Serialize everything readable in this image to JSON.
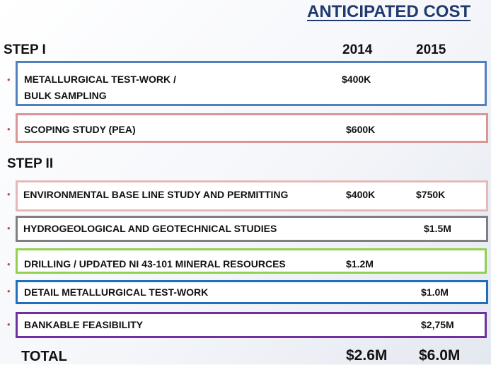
{
  "title": "ANTICIPATED COST",
  "header": {
    "step1": "STEP I",
    "step2": "STEP II",
    "year1": "2014",
    "year2": "2015"
  },
  "bullet": "•",
  "colors": {
    "title": "#1f3a6e",
    "bullet": "#c0504d",
    "blue": "#4f81bd",
    "rose": "#d99694",
    "pink": "#e6b9b8",
    "gray": "#7f7f7f",
    "green": "#92d050",
    "darkblue": "#1f6fbf",
    "purple": "#7030a0"
  },
  "items": [
    {
      "label_line1": "METALLURGICAL TEST-WORK /",
      "label_line2": "BULK SAMPLING",
      "v2014": "$400K",
      "v2015": ""
    },
    {
      "label": "SCOPING STUDY (PEA)",
      "v2014": "$600K",
      "v2015": ""
    },
    {
      "label": "ENVIRONMENTAL BASE LINE STUDY AND PERMITTING",
      "v2014": "$400K",
      "v2015": "$750K"
    },
    {
      "label": "HYDROGEOLOGICAL AND GEOTECHNICAL STUDIES",
      "v2014": "",
      "v2015": "$1.5M"
    },
    {
      "label": "DRILLING / UPDATED NI 43-101 MINERAL RESOURCES",
      "v2014": "$1.2M",
      "v2015": ""
    },
    {
      "label": "DETAIL METALLURGICAL TEST-WORK",
      "v2014": "",
      "v2015": "$1.0M"
    },
    {
      "label": "BANKABLE FEASIBILITY",
      "v2014": "",
      "v2015": "$2,75M"
    }
  ],
  "total": {
    "label": "TOTAL",
    "v2014": "$2.6M",
    "v2015": "$6.0M"
  }
}
